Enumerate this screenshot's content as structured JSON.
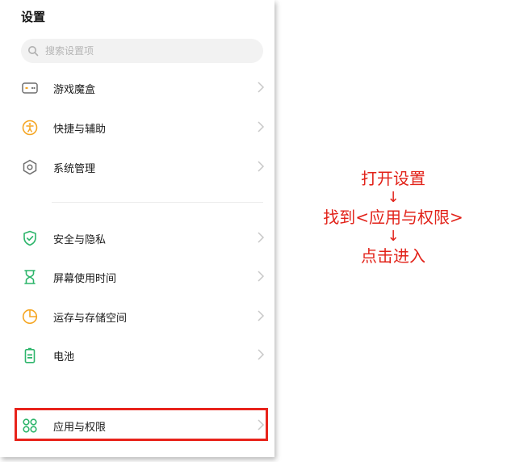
{
  "header": {
    "title": "设置"
  },
  "search": {
    "placeholder": "搜索设置项",
    "value": ""
  },
  "menu": {
    "items": [
      {
        "label": "游戏魔盒",
        "icon": "gamepad-icon"
      },
      {
        "label": "快捷与辅助",
        "icon": "accessibility-icon"
      },
      {
        "label": "系统管理",
        "icon": "hexagon-settings-icon"
      },
      {
        "label": "安全与隐私",
        "icon": "shield-check-icon"
      },
      {
        "label": "屏幕使用时间",
        "icon": "hourglass-icon"
      },
      {
        "label": "运存与存储空间",
        "icon": "pie-chart-icon"
      },
      {
        "label": "电池",
        "icon": "battery-icon"
      },
      {
        "label": "应用与权限",
        "icon": "app-grid-icon"
      }
    ]
  },
  "instructions": {
    "step1": "打开设置",
    "arrow1": "↓",
    "step2": "找到<应用与权限>",
    "arrow2": "↓",
    "step3": "点击进入"
  },
  "colors": {
    "accent_yellow": "#f5a623",
    "accent_green": "#2db56b",
    "icon_gray": "#6f6f6f",
    "highlight_red": "#e8231b",
    "instruction_red": "#e2231a"
  }
}
